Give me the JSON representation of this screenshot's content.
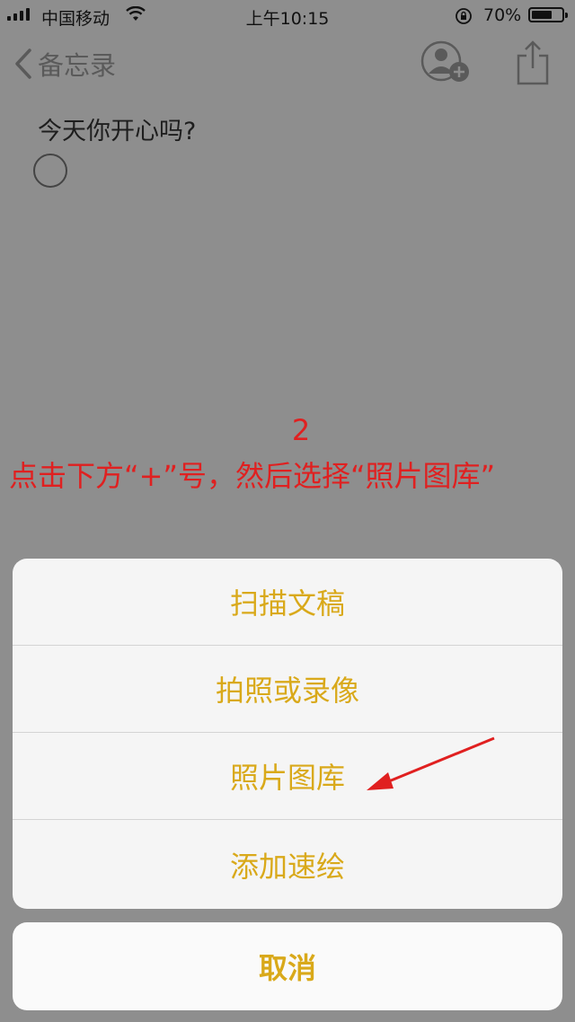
{
  "status_bar": {
    "carrier": "中国移动",
    "time": "上午10:15",
    "battery_percent_text": "70%",
    "battery_level": 0.7,
    "icons": [
      "signal-icon",
      "wifi-icon",
      "orientation-lock-icon",
      "battery-icon"
    ]
  },
  "nav": {
    "back_label": "备忘录",
    "icons": [
      "chevron-left-icon",
      "add-person-icon",
      "share-icon"
    ]
  },
  "note": {
    "title": "今天你开心吗?"
  },
  "annotation": {
    "step": "2",
    "text": "点击下方“+”号，然后选择“照片图库”",
    "color": "#e02020"
  },
  "action_sheet": {
    "items": [
      {
        "label": "扫描文稿"
      },
      {
        "label": "拍照或录像"
      },
      {
        "label": "照片图库"
      },
      {
        "label": "添加速绘"
      }
    ],
    "cancel_label": "取消",
    "accent_color": "#d9a91a"
  }
}
